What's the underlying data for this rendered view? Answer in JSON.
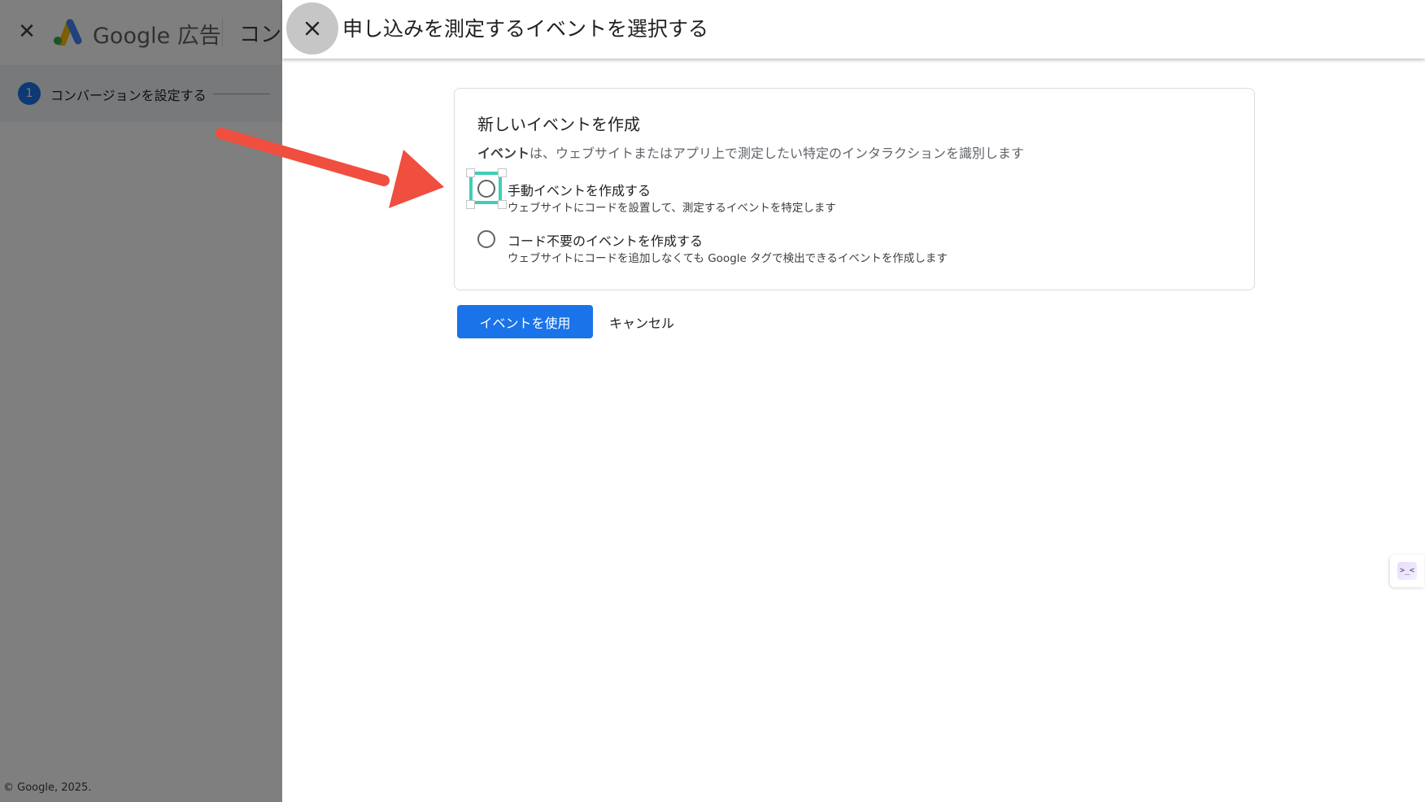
{
  "background_app": {
    "brand": "Google",
    "brand_suffix": "広告",
    "breadcrumb": "コン",
    "step_number": "1",
    "step_label": "コンバージョンを設定する",
    "footer": "© Google, 2025."
  },
  "dialog": {
    "title": "申し込みを測定するイベントを選択する",
    "card": {
      "title": "新しいイベントを作成",
      "desc_bold": "イベント",
      "desc_rest": "は、ウェブサイトまたはアプリ上で測定したい特定のインタラクションを識別します",
      "options": [
        {
          "label": "手動イベントを作成する",
          "sub": "ウェブサイトにコードを設置して、測定するイベントを特定します",
          "selected": false,
          "highlighted": true
        },
        {
          "label": "コード不要のイベントを作成する",
          "sub": "ウェブサイトにコードを追加しなくても Google タグで検出できるイベントを作成します",
          "selected": false,
          "highlighted": false
        }
      ]
    },
    "primary_button": "イベントを使用",
    "cancel_button": "キャンセル"
  },
  "side_widget": {
    "glyph": ">_<"
  },
  "colors": {
    "primary": "#1a73e8",
    "highlight": "#3ecfb6",
    "arrow": "#f04e3e",
    "scrim": "rgba(0,0,0,0.5)"
  },
  "icons": {
    "dialog_close": "close-icon",
    "bg_close": "close-icon",
    "logo": "google-ads-logo-icon",
    "annotation": "arrow-annotation-icon"
  }
}
